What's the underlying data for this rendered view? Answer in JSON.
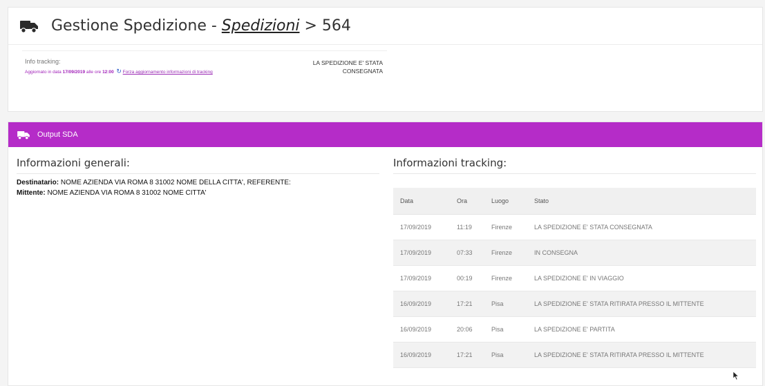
{
  "header": {
    "title_prefix": "Gestione Spedizione - ",
    "breadcrumb_link": "Spedizioni",
    "breadcrumb_suffix": " > 564",
    "icon": "truck-icon"
  },
  "info": {
    "label": "Info tracking:",
    "updated_prefix": "Aggiornato in data ",
    "updated_date": "17/09/2019",
    "updated_mid": " alle ore ",
    "updated_time": "12:00",
    "refresh_icon": "refresh-icon",
    "refresh_label": "Forza aggiornamento informazioni di tracking",
    "status_line1": "LA SPEDIZIONE E' STATA",
    "status_line2": "CONSEGNATA"
  },
  "output_bar": {
    "label": "Output SDA",
    "icon": "truck-icon",
    "color": "#b52cc8"
  },
  "general": {
    "heading": "Informazioni generali:",
    "recipient_label": "Destinatario:",
    "recipient_value": " NOME AZIENDA VIA ROMA 8 31002 NOME DELLA CITTA', REFERENTE:",
    "sender_label": "Mittente:",
    "sender_value": " NOME AZIENDA VIA ROMA 8 31002 NOME CITTA'"
  },
  "tracking": {
    "heading": "Informazioni tracking:",
    "columns": [
      "Data",
      "Ora",
      "Luogo",
      "Stato"
    ],
    "rows": [
      [
        "17/09/2019",
        "11:19",
        "Firenze",
        "LA SPEDIZIONE E' STATA CONSEGNATA"
      ],
      [
        "17/09/2019",
        "07:33",
        "Firenze",
        "IN CONSEGNA"
      ],
      [
        "17/09/2019",
        "00:19",
        "Firenze",
        "LA SPEDIZIONE E' IN VIAGGIO"
      ],
      [
        "16/09/2019",
        "17:21",
        "Pisa",
        "LA SPEDIZIONE E' STATA RITIRATA PRESSO IL MITTENTE"
      ],
      [
        "16/09/2019",
        "20:06",
        "Pisa",
        "LA SPEDIZIONE E' PARTITA"
      ],
      [
        "16/09/2019",
        "17:21",
        "Pisa",
        "LA SPEDIZIONE E' STATA RITIRATA PRESSO IL MITTENTE"
      ]
    ]
  }
}
